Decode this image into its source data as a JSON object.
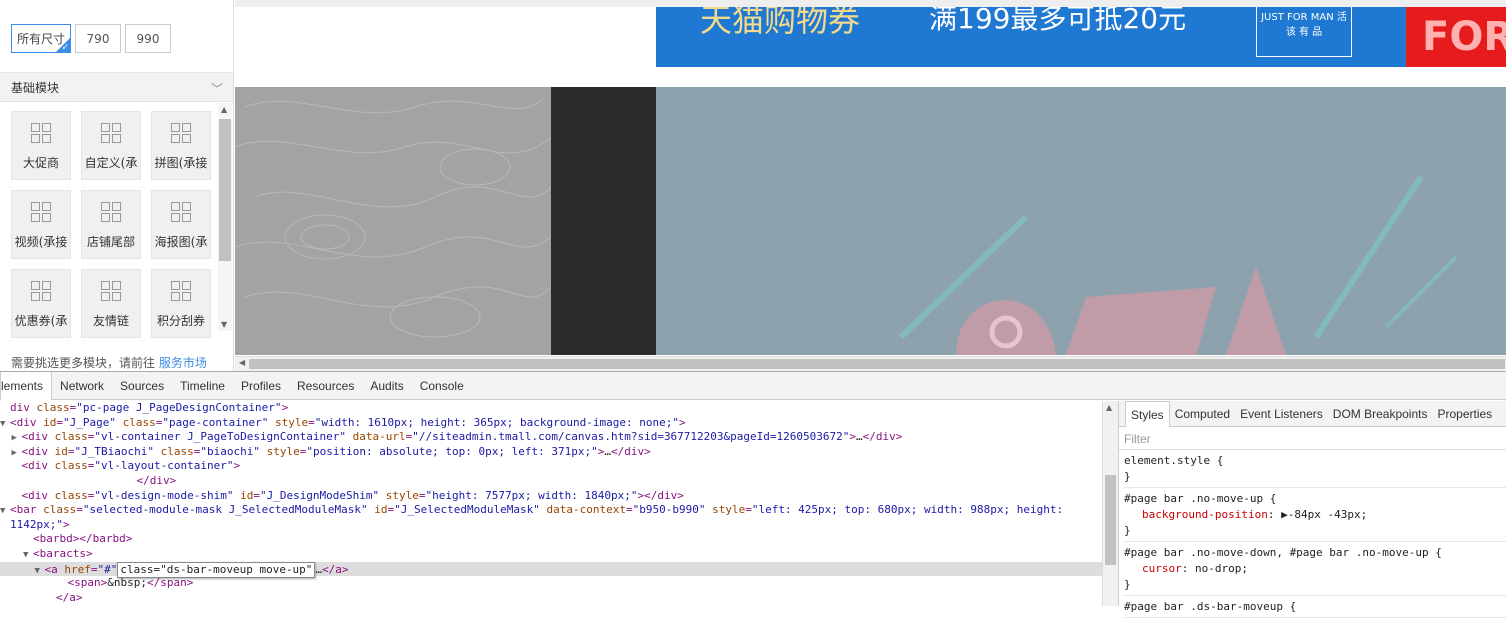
{
  "left_panel": {
    "sizes": [
      "所有尺寸",
      "790",
      "990"
    ],
    "section_title": "基础模块",
    "modules": [
      "大促商",
      "自定义(承",
      "拼图(承接",
      "视频(承接",
      "店铺尾部",
      "海报图(承",
      "优惠券(承",
      "友情链",
      "积分刮券"
    ],
    "footer_text": "需要挑选更多模块，请前往",
    "footer_link": "服务市场"
  },
  "canvas": {
    "banner_text_1": "天猫购物券",
    "banner_text_2": "满199最多可抵20元",
    "banner_badge": "JUST FOR MAN 活 该 有 品",
    "banner_red_text": "FOR"
  },
  "devtools": {
    "tabs": [
      "Elements",
      "Network",
      "Sources",
      "Timeline",
      "Profiles",
      "Resources",
      "Audits",
      "Console"
    ],
    "active_tab_visible": "lements",
    "dom_lines": [
      {
        "indent": 0,
        "toggle": "",
        "parts": [
          [
            "tag",
            "div "
          ],
          [
            "an",
            "class"
          ],
          [
            "tag",
            "="
          ],
          [
            "av",
            "\"pc-page J_PageDesignContainer\""
          ],
          [
            "tag",
            ">"
          ]
        ]
      },
      {
        "indent": 0,
        "toggle": "▼",
        "parts": [
          [
            "tag",
            "<div "
          ],
          [
            "an",
            "id"
          ],
          [
            "tag",
            "="
          ],
          [
            "av",
            "\"J_Page\""
          ],
          [
            "tag",
            " "
          ],
          [
            "an",
            "class"
          ],
          [
            "tag",
            "="
          ],
          [
            "av",
            "\"page-container\""
          ],
          [
            "tag",
            " "
          ],
          [
            "an",
            "style"
          ],
          [
            "tag",
            "="
          ],
          [
            "av",
            "\"width: 1610px; height: 365px; background-image: none;\""
          ],
          [
            "tag",
            ">"
          ]
        ]
      },
      {
        "indent": 1,
        "toggle": "▶",
        "parts": [
          [
            "tag",
            "<div "
          ],
          [
            "an",
            "class"
          ],
          [
            "tag",
            "="
          ],
          [
            "av",
            "\"vl-container J_PageToDesignContainer\""
          ],
          [
            "tag",
            " "
          ],
          [
            "an",
            "data-url"
          ],
          [
            "tag",
            "="
          ],
          [
            "av",
            "\"//siteadmin.tmall.com/canvas.htm?sid=367712203&pageId=1260503672\""
          ],
          [
            "tag",
            ">"
          ],
          [
            "tx",
            "…"
          ],
          [
            "tag",
            "</div>"
          ]
        ]
      },
      {
        "indent": 1,
        "toggle": "▶",
        "parts": [
          [
            "tag",
            "<div "
          ],
          [
            "an",
            "id"
          ],
          [
            "tag",
            "="
          ],
          [
            "av",
            "\"J_TBiaochi\""
          ],
          [
            "tag",
            " "
          ],
          [
            "an",
            "class"
          ],
          [
            "tag",
            "="
          ],
          [
            "av",
            "\"biaochi\""
          ],
          [
            "tag",
            " "
          ],
          [
            "an",
            "style"
          ],
          [
            "tag",
            "="
          ],
          [
            "av",
            "\"position: absolute; top: 0px; left: 371px;\""
          ],
          [
            "tag",
            ">"
          ],
          [
            "tx",
            "…"
          ],
          [
            "tag",
            "</div>"
          ]
        ]
      },
      {
        "indent": 1,
        "toggle": "",
        "parts": [
          [
            "tag",
            "<div "
          ],
          [
            "an",
            "class"
          ],
          [
            "tag",
            "="
          ],
          [
            "av",
            "\"vl-layout-container\""
          ],
          [
            "tag",
            ">"
          ]
        ]
      },
      {
        "indent": 11,
        "toggle": "",
        "parts": [
          [
            "tag",
            "</div>"
          ]
        ]
      },
      {
        "indent": 1,
        "toggle": "",
        "parts": [
          [
            "tag",
            "<div "
          ],
          [
            "an",
            "class"
          ],
          [
            "tag",
            "="
          ],
          [
            "av",
            "\"vl-design-mode-shim\""
          ],
          [
            "tag",
            " "
          ],
          [
            "an",
            "id"
          ],
          [
            "tag",
            "="
          ],
          [
            "av",
            "\"J_DesignModeShim\""
          ],
          [
            "tag",
            " "
          ],
          [
            "an",
            "style"
          ],
          [
            "tag",
            "="
          ],
          [
            "av",
            "\"height: 7577px; width: 1840px;\""
          ],
          [
            "tag",
            "></div>"
          ]
        ]
      },
      {
        "indent": 0,
        "toggle": "▼",
        "parts": [
          [
            "tag",
            "<bar "
          ],
          [
            "an",
            "class"
          ],
          [
            "tag",
            "="
          ],
          [
            "av",
            "\"selected-module-mask J_SelectedModuleMask\""
          ],
          [
            "tag",
            " "
          ],
          [
            "an",
            "id"
          ],
          [
            "tag",
            "="
          ],
          [
            "av",
            "\"J_SelectedModuleMask\""
          ],
          [
            "tag",
            " "
          ],
          [
            "an",
            "data-context"
          ],
          [
            "tag",
            "="
          ],
          [
            "av",
            "\"b950-b990\""
          ],
          [
            "tag",
            " "
          ],
          [
            "an",
            "style"
          ],
          [
            "tag",
            "="
          ],
          [
            "av",
            "\"left: 425px; top: 680px; width: 988px; height:"
          ]
        ]
      },
      {
        "indent": 0,
        "toggle": "",
        "parts": [
          [
            "av",
            "1142px;\""
          ],
          [
            "tag",
            ">"
          ]
        ]
      },
      {
        "indent": 2,
        "toggle": "",
        "parts": [
          [
            "tag",
            "<barbd></barbd>"
          ]
        ]
      },
      {
        "indent": 2,
        "toggle": "▼",
        "parts": [
          [
            "tag",
            "<baracts>"
          ]
        ]
      },
      {
        "indent": 3,
        "toggle": "▼",
        "selected": true,
        "parts": [
          [
            "tag",
            "<a "
          ],
          [
            "an",
            "href"
          ],
          [
            "tag",
            "="
          ],
          [
            "av",
            "\"#\""
          ],
          [
            "edit",
            "class=\"ds-bar-moveup move-up\""
          ],
          [
            "tx",
            "…"
          ],
          [
            "tag",
            "</a>"
          ]
        ]
      },
      {
        "indent": 5,
        "toggle": "",
        "parts": [
          [
            "tag",
            "<span>"
          ],
          [
            "tx",
            "&nbsp;"
          ],
          [
            "tag",
            "</span>"
          ]
        ]
      },
      {
        "indent": 4,
        "toggle": "",
        "parts": [
          [
            "tag",
            "</a>"
          ]
        ]
      }
    ],
    "styles_tabs": [
      "Styles",
      "Computed",
      "Event Listeners",
      "DOM Breakpoints",
      "Properties"
    ],
    "filter_placeholder": "Filter",
    "rules": [
      {
        "selector": "element.style {",
        "props": [],
        "close": "}"
      },
      {
        "selector": "#page bar .no-move-up {",
        "props": [
          [
            "background-position",
            "▶-84px -43px;"
          ]
        ],
        "close": "}"
      },
      {
        "selector": "#page bar .no-move-down, #page bar .no-move-up {",
        "props": [
          [
            "cursor",
            "no-drop;"
          ]
        ],
        "close": "}"
      },
      {
        "selector": "#page bar .ds-bar-moveup {",
        "props": [],
        "close": ""
      }
    ]
  }
}
